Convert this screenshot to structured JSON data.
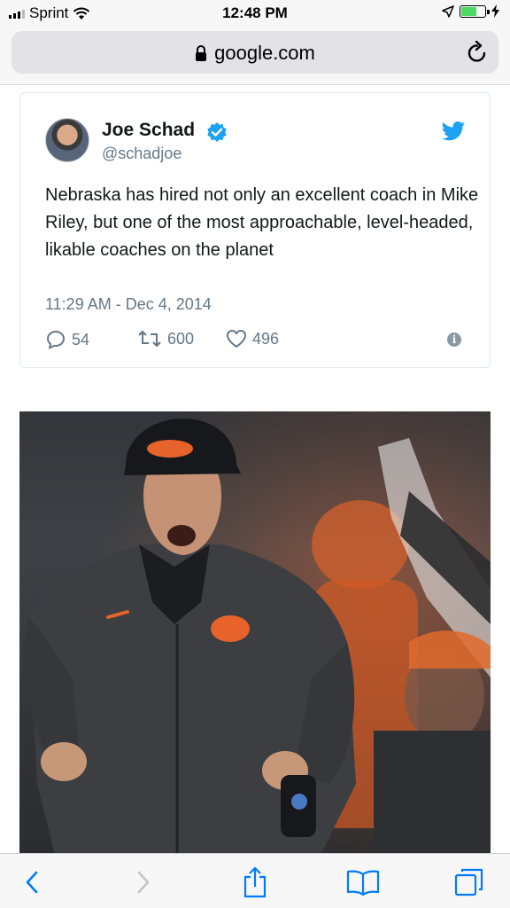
{
  "status_bar": {
    "carrier": "Sprint",
    "time": "12:48 PM"
  },
  "browser": {
    "url": "google.com"
  },
  "tweet": {
    "author_name": "Joe Schad",
    "handle": "@schadjoe",
    "text": "Nebraska has hired not only an excellent coach in Mike Riley, but one of the most approachable, level-headed, likable coaches on the planet",
    "timestamp": "11:29 AM - Dec 4, 2014",
    "replies": "54",
    "retweets": "600",
    "likes": "496"
  },
  "colors": {
    "twitter_blue": "#1da1f2",
    "ios_blue": "#007aff",
    "oregon_orange": "#e8632b"
  }
}
